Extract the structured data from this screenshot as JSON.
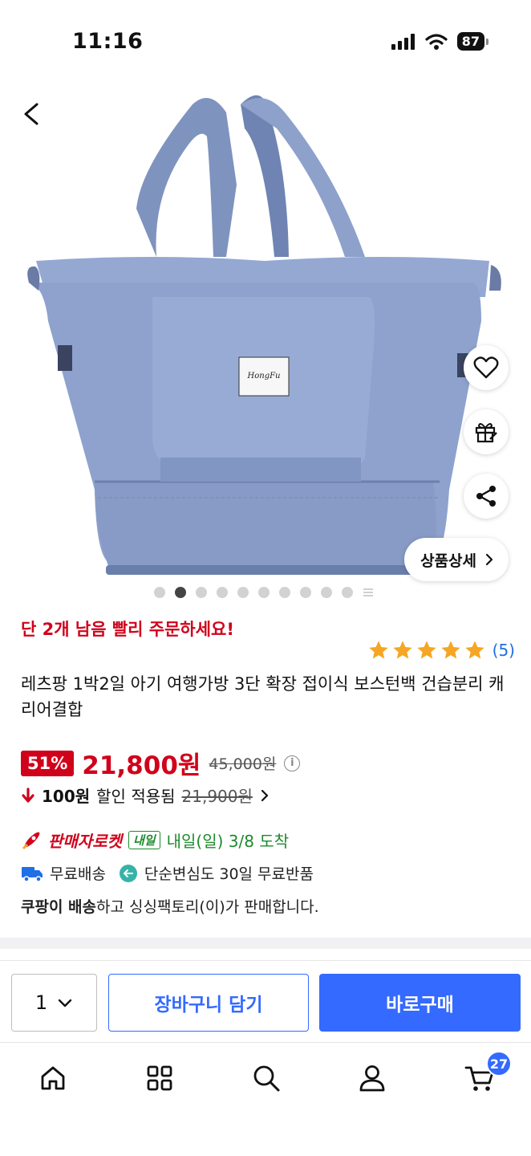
{
  "status": {
    "time": "11:16",
    "battery": "87"
  },
  "product": {
    "urgency": "단 2개 남음 빨리 주문하세요!",
    "rating_count": "(5)",
    "title": "레츠팡 1박2일 아기 여행가방 3단 확장 접이식 보스턴백 건습분리 캐리어결합",
    "discount": "51%",
    "price": "21,800원",
    "original_price": "45,000원",
    "coupon_amount": "100원",
    "coupon_text": "할인 적용됨",
    "coupon_original": "21,900원",
    "rocket_label": "판매자로켓",
    "tomorrow_badge": "내일",
    "arrival": "내일(일) 3/8 도착",
    "free_shipping": "무료배송",
    "free_return": "단순변심도 30일 무료반품",
    "seller_prefix": "쿠팡이 배송",
    "seller_suffix": "하고 싱싱팩토리(이)가 판매합니다.",
    "detail_button": "상품상세",
    "label_brand": "HongFu"
  },
  "image_carousel": {
    "total": 10,
    "active_index": 1
  },
  "buy_bar": {
    "quantity": "1",
    "cart_label": "장바구니 담기",
    "buy_label": "바로구매"
  },
  "tab_bar": {
    "cart_count": "27"
  },
  "colors": {
    "accent": "#346aff",
    "sale": "#d0021b",
    "rocket_green": "#1e8a2d",
    "bag": "#8a9ec8"
  }
}
